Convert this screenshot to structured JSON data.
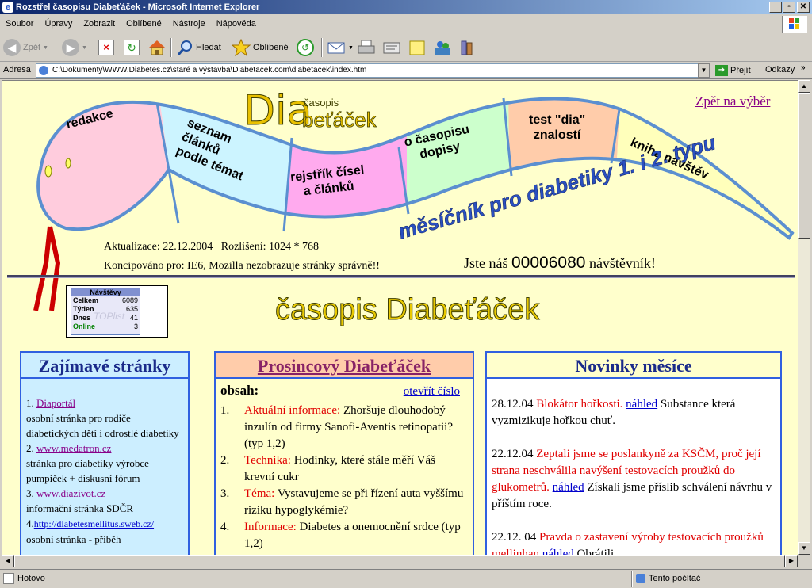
{
  "window": {
    "title": "Rozstřel časopisu Diabeťáček - Microsoft Internet Explorer",
    "ie_glyph": "e",
    "min": "_",
    "max": "▫",
    "close": "✕"
  },
  "menu": [
    "Soubor",
    "Úpravy",
    "Zobrazit",
    "Oblíbené",
    "Nástroje",
    "Nápověda"
  ],
  "toolbar": {
    "back": "Zpět",
    "search": "Hledat",
    "favorites": "Oblíbené"
  },
  "address": {
    "label": "Adresa",
    "value": "C:\\Dokumenty\\WWW.Diabetes.cz\\staré a výstavba\\Diabetacek.com\\diabetacek\\index.htm",
    "go": "Přejít",
    "links": "Odkazy"
  },
  "status": {
    "text": "Hotovo",
    "zone": "Tento počítač"
  },
  "snake": {
    "logo_dia": "Dia",
    "logo_casopis": "časopis",
    "logo_betacek": "beťáček",
    "segments": [
      "redakce",
      "seznam\nčlánků\npodle témat",
      "rejstřík čísel\na článků",
      "o časopisu\ndopisy",
      "test \"dia\"\nznalostí",
      "kniha návštěv"
    ],
    "slogan": "měsíčník pro diabetiky 1. i 2. typu"
  },
  "back_link": "Zpět na výběr",
  "update": "Aktualizace: 22.12.2004   Rozlišení: 1024 * 768",
  "designed": "Koncipováno pro: IE6, Mozilla nezobrazuje stránky správně!!",
  "visitors": {
    "prefix": "Jste náš",
    "count": "00006080",
    "suffix": "návštěvník!"
  },
  "counter": {
    "title": "Návštěvy",
    "rows": [
      {
        "label": "Celkem",
        "value": "6089"
      },
      {
        "label": "Týden",
        "value": "635"
      },
      {
        "label": "Dnes",
        "value": "41"
      },
      {
        "label": "Online",
        "value": "3"
      }
    ],
    "watermark": "TOPlist"
  },
  "main_title": "časopis Diabeťáček",
  "left_box": {
    "title": "Zajímavé stránky",
    "items": [
      {
        "num": "1.",
        "link": "Diaportál",
        "desc": "osobní stránka pro rodiče diabetických dětí i odrostlé diabetiky"
      },
      {
        "num": "2.",
        "link": "www.medatron.cz",
        "desc": "stránka pro diabetiky výrobce pumpiček + diskusní fórum"
      },
      {
        "num": "3.",
        "link": "www.diazivot.cz",
        "desc": "informační stránka SDČR"
      },
      {
        "num": "4.",
        "link": "http://diabetesmellitus.sweb.cz/",
        "desc": "osobní stránka - příběh"
      }
    ]
  },
  "mid_box": {
    "title": "Prosincový Diabeťáček",
    "contents_label": "obsah:",
    "open_issue": "otevřít číslo",
    "items": [
      {
        "num": "1.",
        "cat": "Aktuální informace:",
        "text": "Zhoršuje dlouhodobý inzulín od firmy Sanofi-Aventis retinopatii? (typ 1,2)"
      },
      {
        "num": "2.",
        "cat": "Technika:",
        "text": "Hodinky, které stále měří Váš krevní cukr"
      },
      {
        "num": "3.",
        "cat": "Téma:",
        "text": "Vystavujeme se při řízení auta vyššímu riziku hypoglykémie?"
      },
      {
        "num": "4.",
        "cat": "Informace:",
        "text": "Diabetes a onemocnění srdce (typ 1,2)"
      }
    ]
  },
  "right_box": {
    "title": "Novinky měsíce",
    "items": [
      {
        "date": "28.12.04",
        "headline": "Blokátor hořkosti.",
        "link": "náhled",
        "text": "Substance která vyzmizikuje hořkou chuť."
      },
      {
        "date": "22.12.04",
        "headline": "Zeptali jsme se poslankyně za KSČM, proč její strana neschválila navýšení testovacích proužků do glukometrů.",
        "link": "náhled",
        "text": "Získali jsme příslib schválení návrhu v příštím roce."
      },
      {
        "date": "22.12. 04",
        "headline": "Pravda o zastavení výroby testovacích proužků mellinhan",
        "link": "náhled",
        "text": "Obrátili"
      }
    ]
  }
}
